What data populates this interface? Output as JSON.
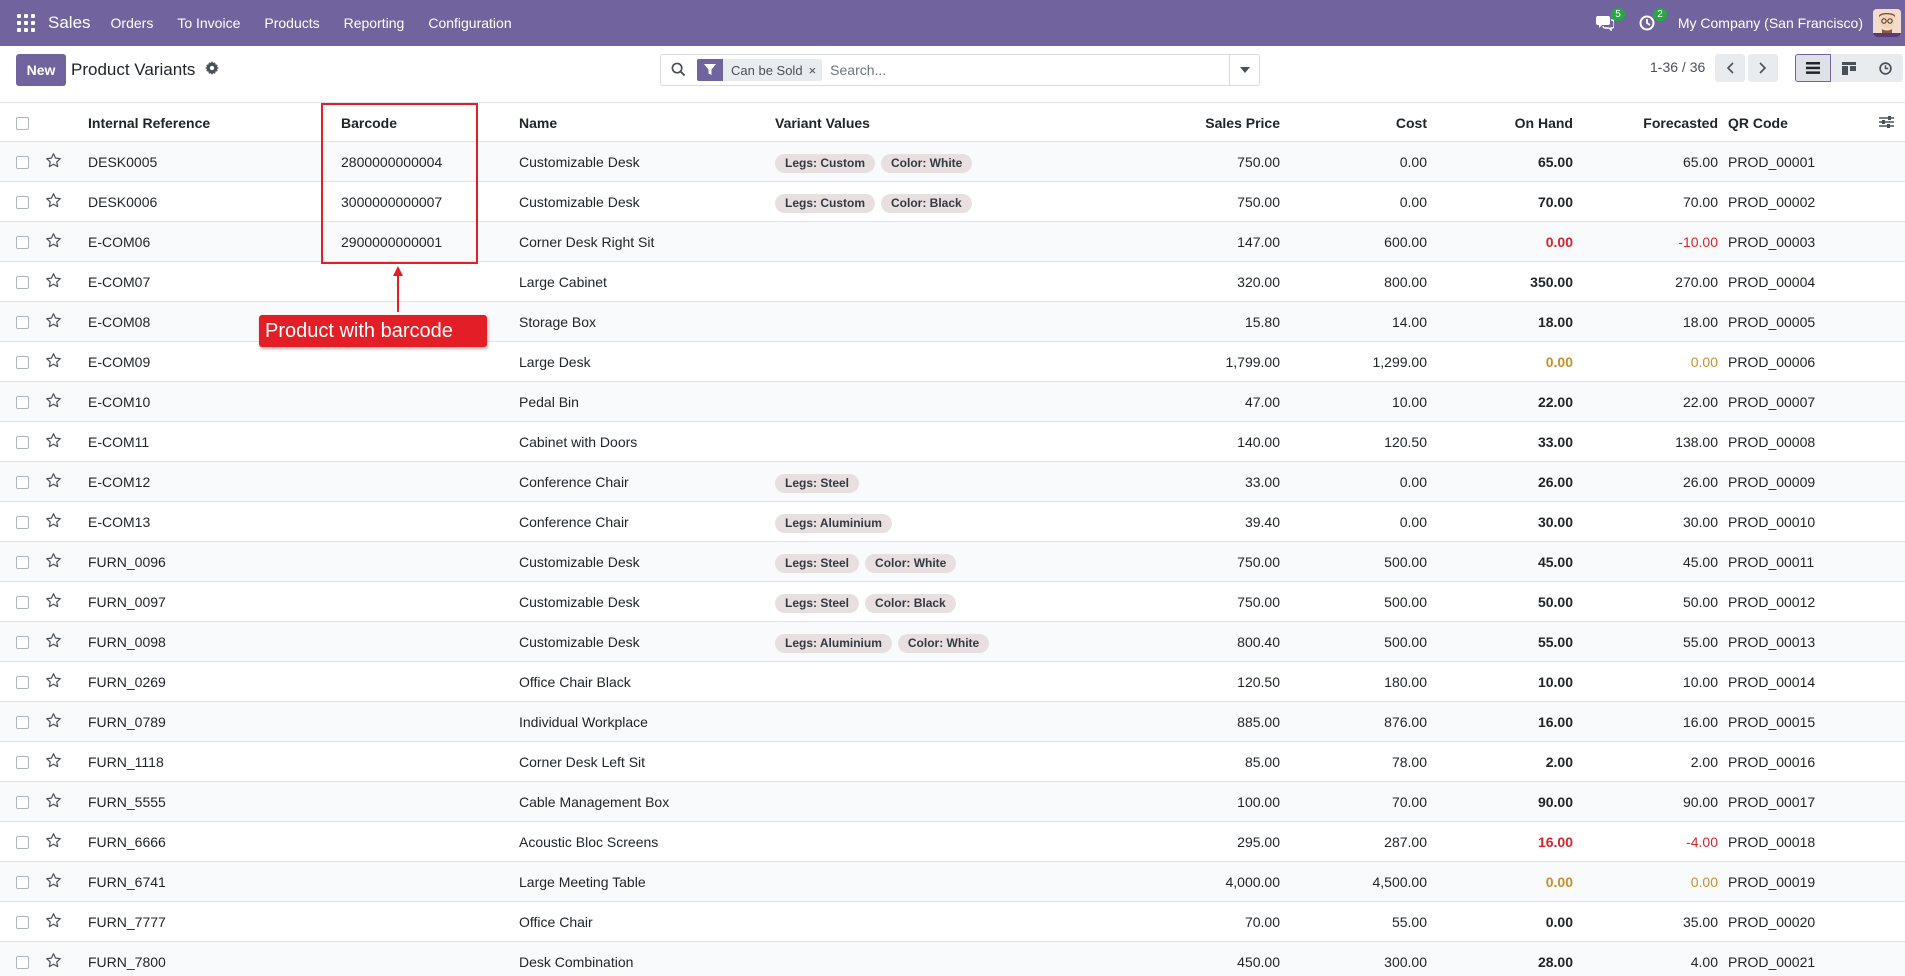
{
  "navbar": {
    "app_name": "Sales",
    "menu": [
      "Orders",
      "To Invoice",
      "Products",
      "Reporting",
      "Configuration"
    ],
    "messages_count": "5",
    "activities_count": "2",
    "company": "My Company (San Francisco)"
  },
  "control": {
    "new_label": "New",
    "title": "Product Variants",
    "facet_label": "Can be Sold",
    "facet_remove": "×",
    "search_placeholder": "Search...",
    "pager": "1-36 / 36"
  },
  "table": {
    "columns": [
      "Internal Reference",
      "Barcode",
      "Name",
      "Variant Values",
      "Sales Price",
      "Cost",
      "On Hand",
      "Forecasted",
      "QR Code"
    ],
    "rows": [
      {
        "ref": "DESK0005",
        "barcode": "2800000000004",
        "name": "Customizable Desk",
        "variants": [
          "Legs: Custom",
          "Color: White"
        ],
        "price": "750.00",
        "cost": "0.00",
        "onhand": "65.00",
        "forecast": "65.00",
        "qr": "PROD_00001"
      },
      {
        "ref": "DESK0006",
        "barcode": "3000000000007",
        "name": "Customizable Desk",
        "variants": [
          "Legs: Custom",
          "Color: Black"
        ],
        "price": "750.00",
        "cost": "0.00",
        "onhand": "70.00",
        "forecast": "70.00",
        "qr": "PROD_00002"
      },
      {
        "ref": "E-COM06",
        "barcode": "2900000000001",
        "name": "Corner Desk Right Sit",
        "variants": [],
        "price": "147.00",
        "cost": "600.00",
        "onhand": "0.00",
        "forecast": "-10.00",
        "qr": "PROD_00003",
        "onhand_status": "red",
        "forecast_status": "red"
      },
      {
        "ref": "E-COM07",
        "barcode": "",
        "name": "Large Cabinet",
        "variants": [],
        "price": "320.00",
        "cost": "800.00",
        "onhand": "350.00",
        "forecast": "270.00",
        "qr": "PROD_00004"
      },
      {
        "ref": "E-COM08",
        "barcode": "",
        "name": "Storage Box",
        "variants": [],
        "price": "15.80",
        "cost": "14.00",
        "onhand": "18.00",
        "forecast": "18.00",
        "qr": "PROD_00005"
      },
      {
        "ref": "E-COM09",
        "barcode": "",
        "name": "Large Desk",
        "variants": [],
        "price": "1,799.00",
        "cost": "1,299.00",
        "onhand": "0.00",
        "forecast": "0.00",
        "qr": "PROD_00006",
        "onhand_status": "amber",
        "forecast_status": "amber"
      },
      {
        "ref": "E-COM10",
        "barcode": "",
        "name": "Pedal Bin",
        "variants": [],
        "price": "47.00",
        "cost": "10.00",
        "onhand": "22.00",
        "forecast": "22.00",
        "qr": "PROD_00007"
      },
      {
        "ref": "E-COM11",
        "barcode": "",
        "name": "Cabinet with Doors",
        "variants": [],
        "price": "140.00",
        "cost": "120.50",
        "onhand": "33.00",
        "forecast": "138.00",
        "qr": "PROD_00008"
      },
      {
        "ref": "E-COM12",
        "barcode": "",
        "name": "Conference Chair",
        "variants": [
          "Legs: Steel"
        ],
        "price": "33.00",
        "cost": "0.00",
        "onhand": "26.00",
        "forecast": "26.00",
        "qr": "PROD_00009"
      },
      {
        "ref": "E-COM13",
        "barcode": "",
        "name": "Conference Chair",
        "variants": [
          "Legs: Aluminium"
        ],
        "price": "39.40",
        "cost": "0.00",
        "onhand": "30.00",
        "forecast": "30.00",
        "qr": "PROD_00010"
      },
      {
        "ref": "FURN_0096",
        "barcode": "",
        "name": "Customizable Desk",
        "variants": [
          "Legs: Steel",
          "Color: White"
        ],
        "price": "750.00",
        "cost": "500.00",
        "onhand": "45.00",
        "forecast": "45.00",
        "qr": "PROD_00011"
      },
      {
        "ref": "FURN_0097",
        "barcode": "",
        "name": "Customizable Desk",
        "variants": [
          "Legs: Steel",
          "Color: Black"
        ],
        "price": "750.00",
        "cost": "500.00",
        "onhand": "50.00",
        "forecast": "50.00",
        "qr": "PROD_00012"
      },
      {
        "ref": "FURN_0098",
        "barcode": "",
        "name": "Customizable Desk",
        "variants": [
          "Legs: Aluminium",
          "Color: White"
        ],
        "price": "800.40",
        "cost": "500.00",
        "onhand": "55.00",
        "forecast": "55.00",
        "qr": "PROD_00013"
      },
      {
        "ref": "FURN_0269",
        "barcode": "",
        "name": "Office Chair Black",
        "variants": [],
        "price": "120.50",
        "cost": "180.00",
        "onhand": "10.00",
        "forecast": "10.00",
        "qr": "PROD_00014"
      },
      {
        "ref": "FURN_0789",
        "barcode": "",
        "name": "Individual Workplace",
        "variants": [],
        "price": "885.00",
        "cost": "876.00",
        "onhand": "16.00",
        "forecast": "16.00",
        "qr": "PROD_00015"
      },
      {
        "ref": "FURN_1118",
        "barcode": "",
        "name": "Corner Desk Left Sit",
        "variants": [],
        "price": "85.00",
        "cost": "78.00",
        "onhand": "2.00",
        "forecast": "2.00",
        "qr": "PROD_00016"
      },
      {
        "ref": "FURN_5555",
        "barcode": "",
        "name": "Cable Management Box",
        "variants": [],
        "price": "100.00",
        "cost": "70.00",
        "onhand": "90.00",
        "forecast": "90.00",
        "qr": "PROD_00017"
      },
      {
        "ref": "FURN_6666",
        "barcode": "",
        "name": "Acoustic Bloc Screens",
        "variants": [],
        "price": "295.00",
        "cost": "287.00",
        "onhand": "16.00",
        "forecast": "-4.00",
        "qr": "PROD_00018",
        "onhand_status": "red",
        "forecast_status": "red"
      },
      {
        "ref": "FURN_6741",
        "barcode": "",
        "name": "Large Meeting Table",
        "variants": [],
        "price": "4,000.00",
        "cost": "4,500.00",
        "onhand": "0.00",
        "forecast": "0.00",
        "qr": "PROD_00019",
        "onhand_status": "amber",
        "forecast_status": "amber"
      },
      {
        "ref": "FURN_7777",
        "barcode": "",
        "name": "Office Chair",
        "variants": [],
        "price": "70.00",
        "cost": "55.00",
        "onhand": "0.00",
        "forecast": "35.00",
        "qr": "PROD_00020"
      },
      {
        "ref": "FURN_7800",
        "barcode": "",
        "name": "Desk Combination",
        "variants": [],
        "price": "450.00",
        "cost": "300.00",
        "onhand": "28.00",
        "forecast": "4.00",
        "qr": "PROD_00021"
      }
    ]
  },
  "annotation": {
    "label": "Product with barcode"
  },
  "colors": {
    "brand": "#71639e",
    "danger": "#d9232d",
    "warning": "#c6912b",
    "annotation": "#e41e26"
  },
  "icons": {
    "apps": "apps-grid-icon",
    "messages": "chat-icon",
    "activities": "clock-icon",
    "gear": "gear-icon",
    "search": "search-icon",
    "filter": "filter-icon",
    "star": "star-icon",
    "list_view": "list-view-icon",
    "kanban_view": "kanban-view-icon",
    "activity_view": "activity-view-icon",
    "optional_columns": "settings-sliders-icon"
  }
}
